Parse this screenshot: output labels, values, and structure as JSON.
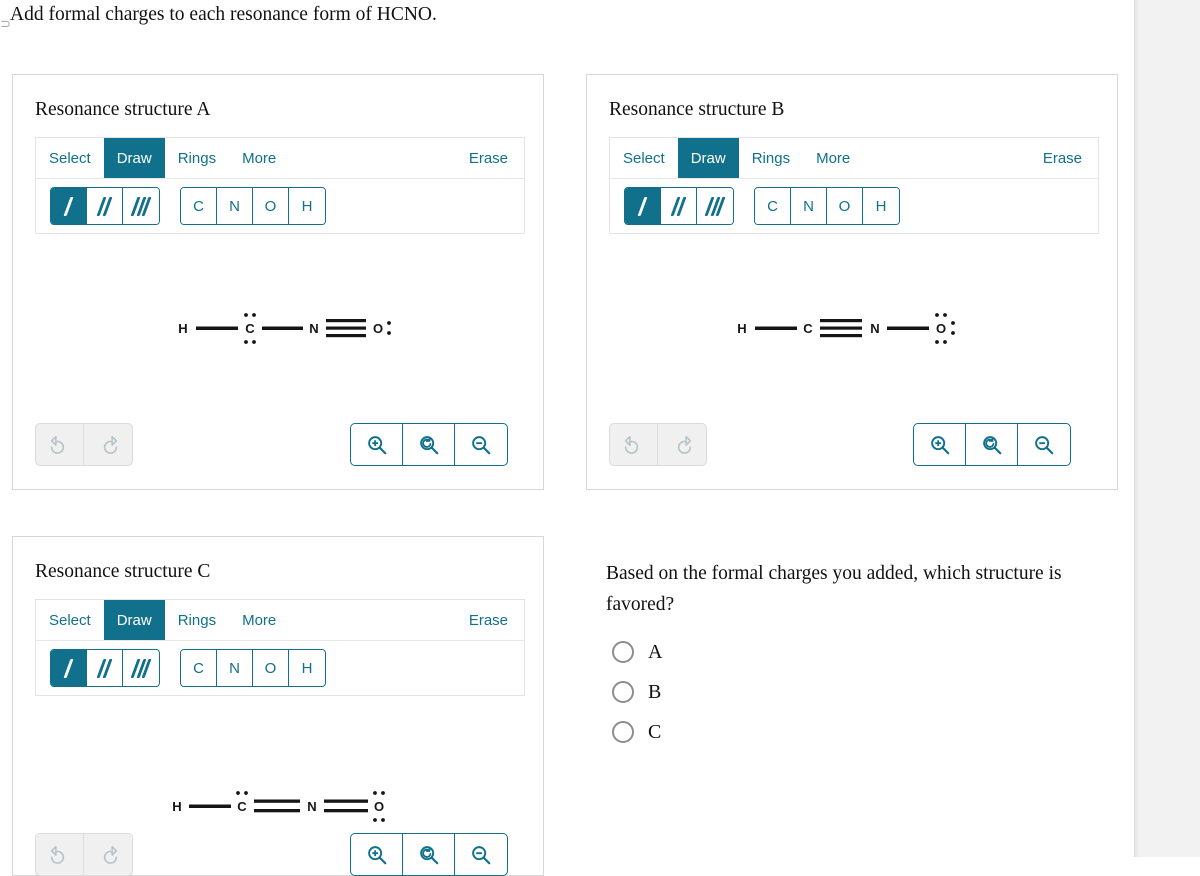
{
  "prompt": {
    "text": "Add formal charges to each resonance form of HCNO.",
    "stray_glyph": "⊃"
  },
  "toolbar": {
    "tabs": [
      {
        "label": "Select",
        "active": false
      },
      {
        "label": "Draw",
        "active": true
      },
      {
        "label": "Rings",
        "active": false
      },
      {
        "label": "More",
        "active": false
      }
    ],
    "erase_label": "Erase",
    "bond_tools": [
      {
        "name": "single-bond",
        "strokes": 1,
        "active": true
      },
      {
        "name": "double-bond",
        "strokes": 2,
        "active": false
      },
      {
        "name": "triple-bond",
        "strokes": 3,
        "active": false
      }
    ],
    "atom_tools": [
      {
        "label": "C"
      },
      {
        "label": "N"
      },
      {
        "label": "O"
      },
      {
        "label": "H"
      }
    ]
  },
  "controls": {
    "undo_label": "undo",
    "redo_label": "redo",
    "zoom_in_label": "zoom-in",
    "zoom_reset_label": "zoom-reset",
    "zoom_out_label": "zoom-out",
    "undo_enabled": false,
    "redo_enabled": false
  },
  "panels": [
    {
      "id": "A",
      "title": "Resonance structure A",
      "structure": {
        "formula": "H—C—N≡O",
        "atoms": [
          "H",
          "C",
          "N",
          "O"
        ],
        "bonds": [
          "single",
          "single",
          "triple"
        ],
        "lone_pairs": {
          "C": [
            "top",
            "bottom"
          ],
          "O": [
            "right"
          ]
        }
      }
    },
    {
      "id": "B",
      "title": "Resonance structure B",
      "structure": {
        "formula": "H—C≡N—O",
        "atoms": [
          "H",
          "C",
          "N",
          "O"
        ],
        "bonds": [
          "single",
          "triple",
          "single"
        ],
        "lone_pairs": {
          "O": [
            "top",
            "bottom",
            "right"
          ]
        }
      }
    },
    {
      "id": "C",
      "title": "Resonance structure C",
      "structure": {
        "formula": "H—C=N=O",
        "atoms": [
          "H",
          "C",
          "N",
          "O"
        ],
        "bonds": [
          "single",
          "double",
          "double"
        ],
        "lone_pairs": {
          "C": [
            "top"
          ],
          "O": [
            "top",
            "bottom"
          ]
        }
      }
    }
  ],
  "question": {
    "text": "Based on the formal charges you added, which structure is favored?",
    "options": [
      {
        "label": "A",
        "selected": false
      },
      {
        "label": "B",
        "selected": false
      },
      {
        "label": "C",
        "selected": false
      }
    ]
  },
  "colors": {
    "accent": "#11708b",
    "panel_border": "#d6d6d6",
    "rail_bg": "#f2f2f2",
    "disabled": "#b6c4c9"
  }
}
